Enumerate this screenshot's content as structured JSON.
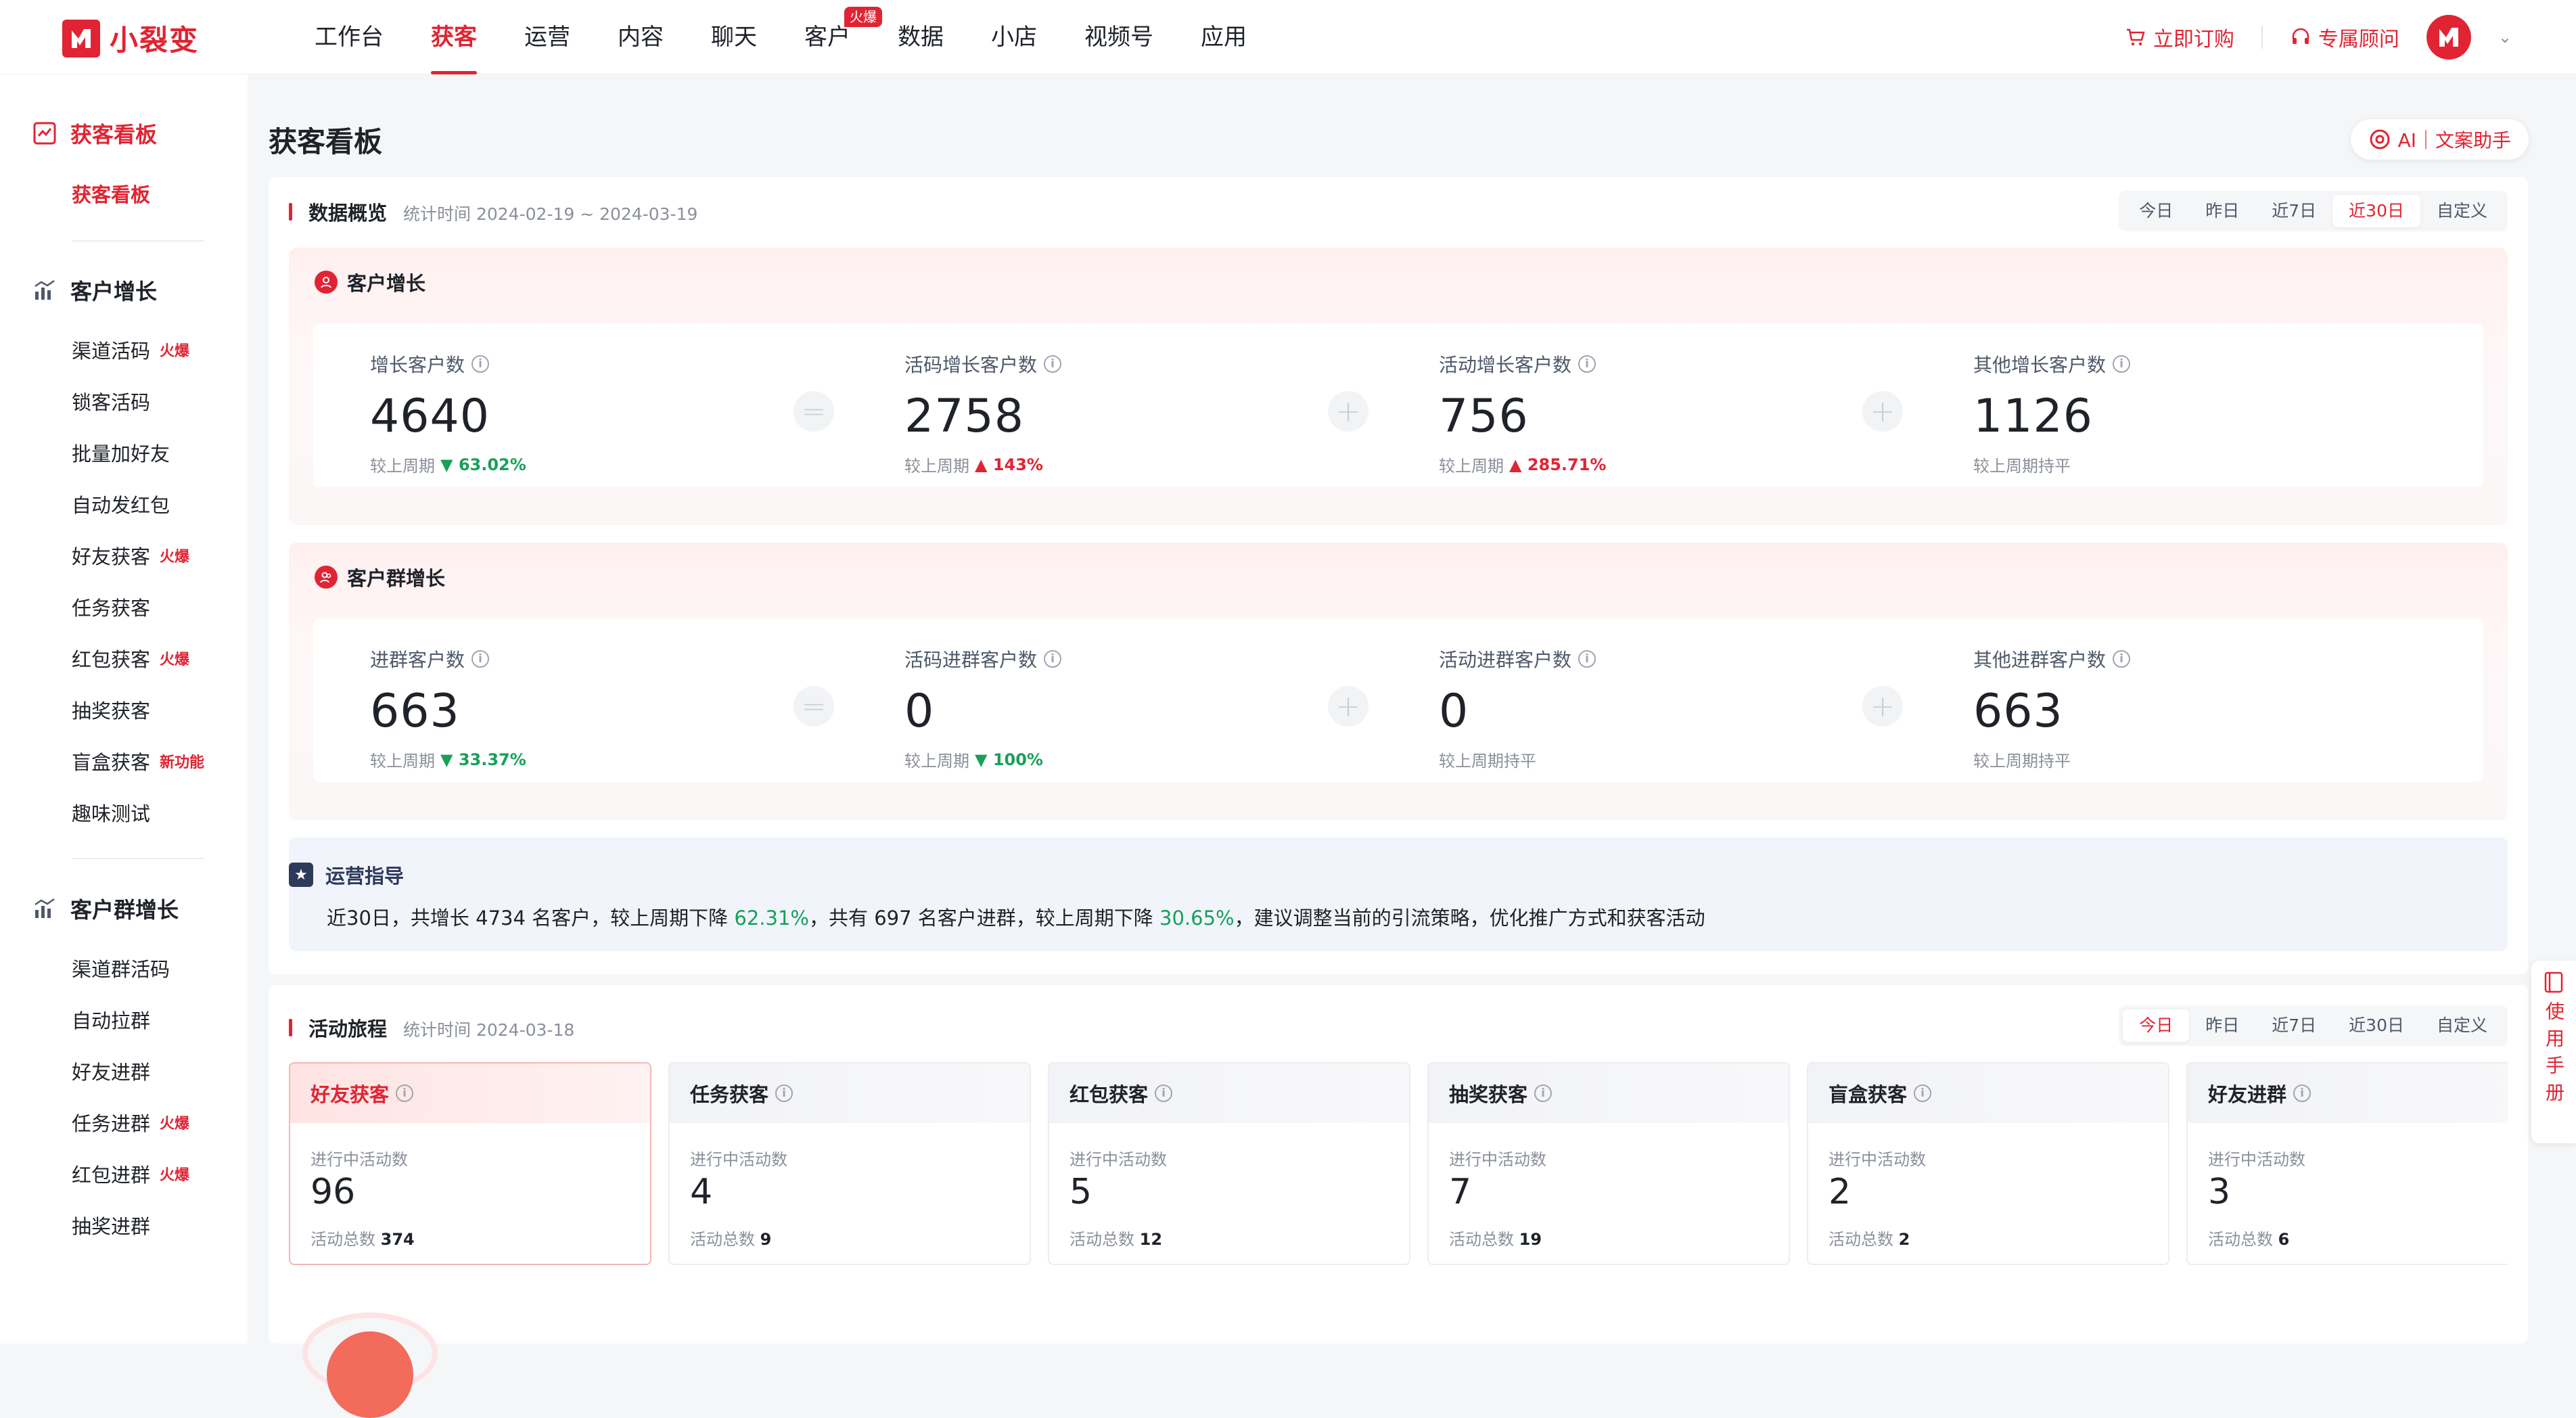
{
  "app": {
    "logo_text": "小裂变"
  },
  "nav": {
    "items": [
      {
        "label": "工作台"
      },
      {
        "label": "获客"
      },
      {
        "label": "运营"
      },
      {
        "label": "内容"
      },
      {
        "label": "聊天"
      },
      {
        "label": "客户",
        "badge": "火爆"
      },
      {
        "label": "数据"
      },
      {
        "label": "小店"
      },
      {
        "label": "视频号"
      },
      {
        "label": "应用"
      }
    ],
    "active": "获客",
    "order_label": "立即订购",
    "advisor_label": "专属顾问"
  },
  "sidebar": {
    "group1": {
      "title": "获客看板",
      "items": [
        {
          "label": "获客看板"
        }
      ]
    },
    "group2": {
      "title": "客户增长",
      "items": [
        {
          "label": "渠道活码",
          "tag": "火爆"
        },
        {
          "label": "锁客活码"
        },
        {
          "label": "批量加好友"
        },
        {
          "label": "自动发红包"
        },
        {
          "label": "好友获客",
          "tag": "火爆"
        },
        {
          "label": "任务获客"
        },
        {
          "label": "红包获客",
          "tag": "火爆"
        },
        {
          "label": "抽奖获客"
        },
        {
          "label": "盲盒获客",
          "tag": "新功能"
        },
        {
          "label": "趣味测试"
        }
      ]
    },
    "group3": {
      "title": "客户群增长",
      "items": [
        {
          "label": "渠道群活码"
        },
        {
          "label": "自动拉群"
        },
        {
          "label": "好友进群"
        },
        {
          "label": "任务进群",
          "tag": "火爆"
        },
        {
          "label": "红包进群",
          "tag": "火爆"
        },
        {
          "label": "抽奖进群"
        }
      ]
    }
  },
  "page": {
    "title": "获客看板",
    "ai_button": "AI｜文案助手"
  },
  "overview": {
    "title": "数据概览",
    "period": "统计时间 2024-02-19 ~ 2024-03-19",
    "ranges": [
      "今日",
      "昨日",
      "近7日",
      "近30日",
      "自定义"
    ],
    "active_range": "近30日",
    "customer_growth": {
      "title": "客户增长",
      "metrics": [
        {
          "label": "增长客户数",
          "value": "4640",
          "compare_prefix": "较上周期",
          "trend": "down",
          "change": "63.02%"
        },
        {
          "label": "活码增长客户数",
          "value": "2758",
          "compare_prefix": "较上周期",
          "trend": "up",
          "change": "143%"
        },
        {
          "label": "活动增长客户数",
          "value": "756",
          "compare_prefix": "较上周期",
          "trend": "up",
          "change": "285.71%"
        },
        {
          "label": "其他增长客户数",
          "value": "1126",
          "compare_prefix": "较上周期持平",
          "trend": "flat",
          "change": ""
        }
      ]
    },
    "group_growth": {
      "title": "客户群增长",
      "metrics": [
        {
          "label": "进群客户数",
          "value": "663",
          "compare_prefix": "较上周期",
          "trend": "down",
          "change": "33.37%"
        },
        {
          "label": "活码进群客户数",
          "value": "0",
          "compare_prefix": "较上周期",
          "trend": "down",
          "change": "100%"
        },
        {
          "label": "活动进群客户数",
          "value": "0",
          "compare_prefix": "较上周期持平",
          "trend": "flat",
          "change": ""
        },
        {
          "label": "其他进群客户数",
          "value": "663",
          "compare_prefix": "较上周期持平",
          "trend": "flat",
          "change": ""
        }
      ]
    },
    "guide": {
      "title": "运营指导",
      "t1": "近30日，共增长",
      "n1": "4734",
      "t2": "名客户，较上周期下降",
      "p1": "62.31%",
      "t3": "，共有",
      "n2": "697",
      "t4": "名客户进群，较上周期下降",
      "p2": "30.65%",
      "t5": "，建议调整当前的引流策略，优化推广方式和获客活动"
    }
  },
  "journey": {
    "title": "活动旅程",
    "period": "统计时间 2024-03-18",
    "ranges": [
      "今日",
      "昨日",
      "近7日",
      "近30日",
      "自定义"
    ],
    "active_range": "今日",
    "cards": [
      {
        "title": "好友获客",
        "label": "进行中活动数",
        "value": "96",
        "total_label": "活动总数",
        "total": "374"
      },
      {
        "title": "任务获客",
        "label": "进行中活动数",
        "value": "4",
        "total_label": "活动总数",
        "total": "9"
      },
      {
        "title": "红包获客",
        "label": "进行中活动数",
        "value": "5",
        "total_label": "活动总数",
        "total": "12"
      },
      {
        "title": "抽奖获客",
        "label": "进行中活动数",
        "value": "7",
        "total_label": "活动总数",
        "total": "19"
      },
      {
        "title": "盲盒获客",
        "label": "进行中活动数",
        "value": "2",
        "total_label": "活动总数",
        "total": "2"
      },
      {
        "title": "好友进群",
        "label": "进行中活动数",
        "value": "3",
        "total_label": "活动总数",
        "total": "6"
      }
    ]
  },
  "side_tab": {
    "label": "使用手册"
  },
  "colors": {
    "brand": "#e02433",
    "down": "#18a058",
    "up": "#e02433"
  }
}
